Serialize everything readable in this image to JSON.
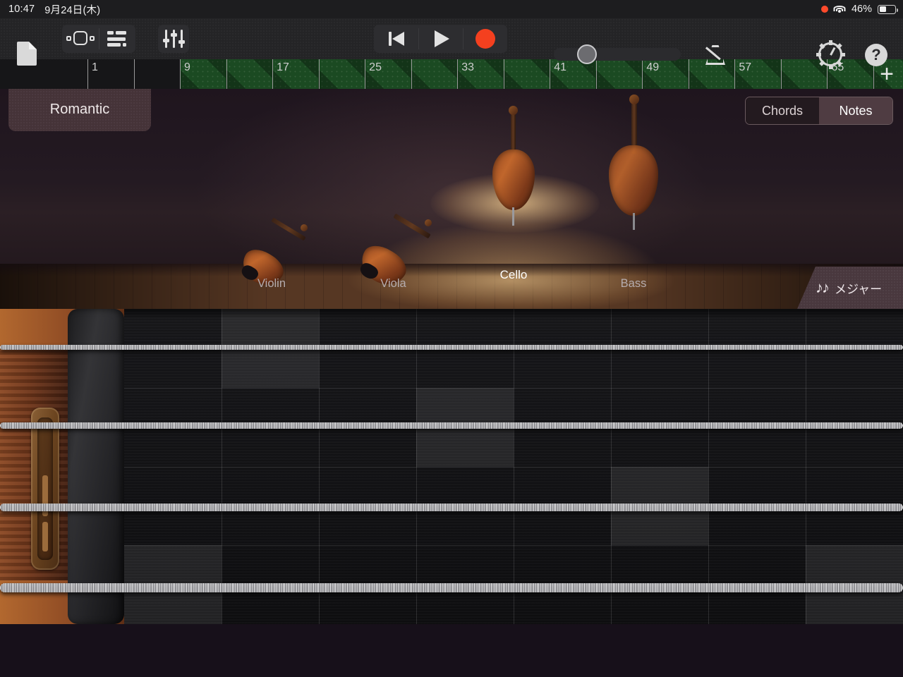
{
  "status_bar": {
    "time": "10:47",
    "date": "9月24日(木)",
    "recording_indicator": "record-dot",
    "wifi": "wifi-icon",
    "battery_percent": "46%",
    "battery_level": 46
  },
  "toolbar": {
    "document_icon": "document-icon",
    "browser_icon": "instrument-browser-icon",
    "tracks_icon": "track-view-icon",
    "mixer_icon": "mixer-faders-icon",
    "rewind_label": "rewind-icon",
    "play_label": "play-icon",
    "record_label": "record-icon",
    "metronome_icon": "metronome-icon",
    "settings_icon": "gear-icon",
    "help_icon": "help-icon",
    "master_volume": 27,
    "record_color": "#f4401f"
  },
  "ruler": {
    "bars": [
      "1",
      "9",
      "17",
      "25",
      "33",
      "41",
      "49",
      "57",
      "65"
    ],
    "playhead_bar": "1",
    "add_track_label": "+",
    "loop_color": "#1b4a22"
  },
  "preset": {
    "name": "Romantic"
  },
  "view_toggle": {
    "options": [
      "Chords",
      "Notes"
    ],
    "selected": "Notes"
  },
  "stage": {
    "instruments": [
      {
        "name": "Violin",
        "selected": false
      },
      {
        "name": "Viola",
        "selected": false
      },
      {
        "name": "Cello",
        "selected": true
      },
      {
        "name": "Bass",
        "selected": false
      }
    ]
  },
  "scale_badge": {
    "notes_glyph": "♪♪",
    "label": "メジャー"
  },
  "fretboard": {
    "instrument": "Cello",
    "string_count": 4,
    "column_count": 8,
    "lit_cells": [
      {
        "col": 1,
        "row": 0
      },
      {
        "col": 1,
        "row": 1
      },
      {
        "col": 3,
        "row": 2
      },
      {
        "col": 3,
        "row": 3
      },
      {
        "col": 5,
        "row": 4
      },
      {
        "col": 5,
        "row": 5
      },
      {
        "col": 0,
        "row": 6
      },
      {
        "col": 0,
        "row": 7
      },
      {
        "col": 7,
        "row": 6
      },
      {
        "col": 7,
        "row": 7
      }
    ]
  }
}
